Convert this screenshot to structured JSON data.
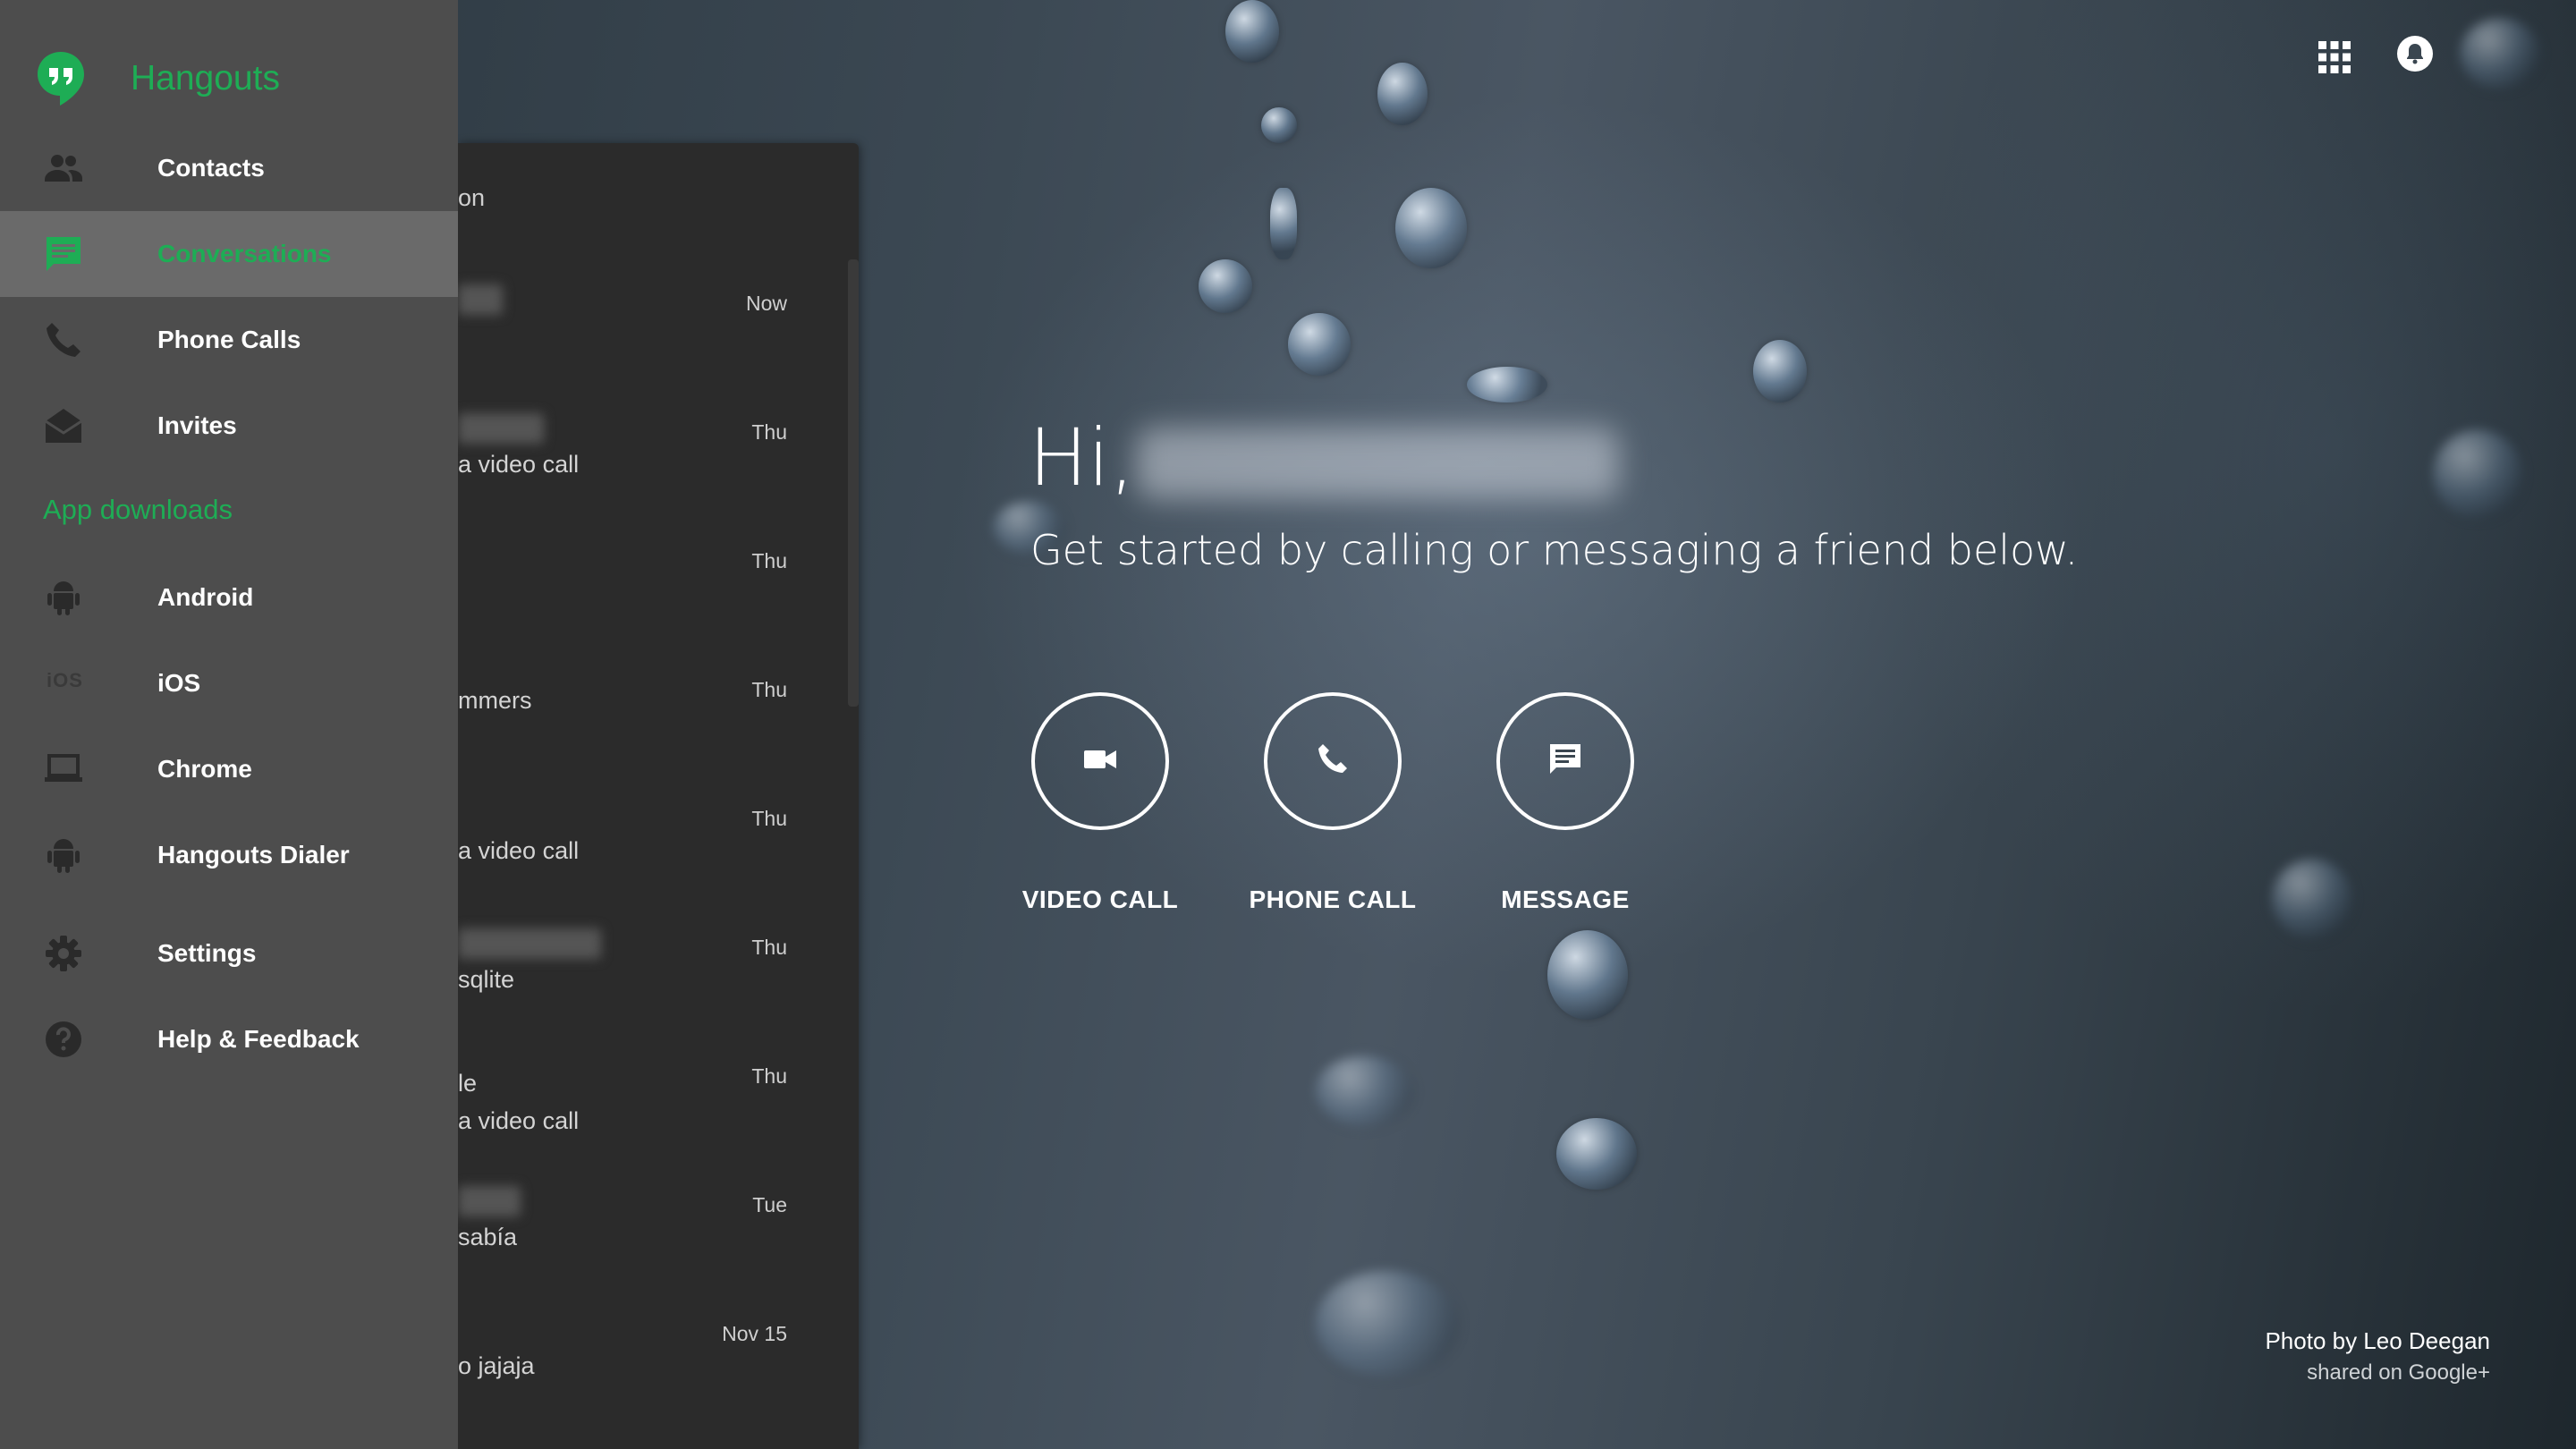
{
  "app": {
    "name": "Hangouts",
    "accent_color": "#1ead55"
  },
  "sidebar": {
    "items": [
      {
        "label": "Contacts",
        "icon": "contacts-icon"
      },
      {
        "label": "Conversations",
        "icon": "chat-icon",
        "active": true
      },
      {
        "label": "Phone Calls",
        "icon": "phone-icon"
      },
      {
        "label": "Invites",
        "icon": "mail-open-icon"
      }
    ],
    "section_title": "App downloads",
    "downloads": [
      {
        "label": "Android",
        "icon": "android-icon"
      },
      {
        "label": "iOS",
        "icon": "ios-icon",
        "glyph": "iOS"
      },
      {
        "label": "Chrome",
        "icon": "laptop-icon"
      },
      {
        "label": "Hangouts Dialer",
        "icon": "android-icon"
      }
    ],
    "footer_items": [
      {
        "label": "Settings",
        "icon": "gear-icon"
      },
      {
        "label": "Help & Feedback",
        "icon": "help-icon"
      }
    ]
  },
  "conversations": {
    "heading": "on",
    "rows": [
      {
        "snippet": "",
        "time": "Now"
      },
      {
        "snippet": "a video call",
        "time": "Thu"
      },
      {
        "snippet": "",
        "time": "Thu"
      },
      {
        "snippet": "mmers",
        "time": "Thu"
      },
      {
        "snippet": "a video call",
        "time": "Thu"
      },
      {
        "snippet": "sqlite",
        "time": "Thu"
      },
      {
        "snippet": "le\na video call",
        "time": "Thu"
      },
      {
        "snippet": "sabía",
        "time": "Tue"
      },
      {
        "snippet": "o jajaja",
        "time": "Nov 15"
      }
    ]
  },
  "welcome": {
    "greeting": "Hi,",
    "subtitle": "Get started by calling or messaging a friend below."
  },
  "actions": [
    {
      "label": "VIDEO CALL",
      "icon": "video-camera-icon"
    },
    {
      "label": "PHONE CALL",
      "icon": "phone-icon"
    },
    {
      "label": "MESSAGE",
      "icon": "message-icon"
    }
  ],
  "topbar": {
    "apps_icon": "apps-grid-icon",
    "notifications_icon": "bell-icon"
  },
  "credit": {
    "line1": "Photo by Leo Deegan",
    "line2": "shared on Google+"
  }
}
